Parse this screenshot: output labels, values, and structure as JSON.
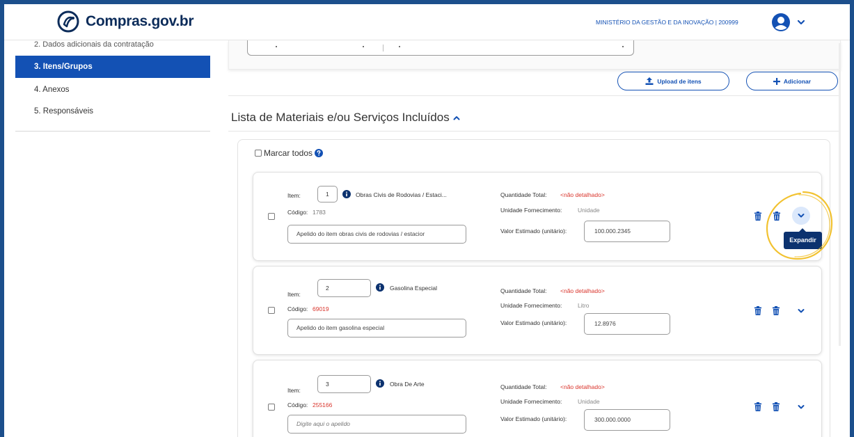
{
  "header": {
    "logo_text": "Compras.gov.br",
    "organization": "MINISTÉRIO DA GESTÃO E DA INOVAÇÃO | 200999"
  },
  "sidebar": {
    "items": [
      {
        "label": "2. Dados adicionais da contratação",
        "active": false
      },
      {
        "label": "3. Itens/Grupos",
        "active": true
      },
      {
        "label": "4. Anexos",
        "active": false
      },
      {
        "label": "5. Responsáveis",
        "active": false
      }
    ]
  },
  "toolbar": {
    "upload_label": "Upload de itens",
    "add_label": "Adicionar"
  },
  "section": {
    "title": "Lista de Materiais e/ou Serviços Incluídos",
    "select_all_label": "Marcar todos"
  },
  "labels": {
    "item": "Item:",
    "codigo": "Código:",
    "quantidade_total": "Quantidade Total:",
    "unidade_fornecimento": "Unidade Fornecimento:",
    "valor_estimado": "Valor Estimado (unitário):"
  },
  "items": [
    {
      "number": "1",
      "name": "Obras Civis de Rodovias / Estaci...",
      "codigo": "1783",
      "apelido": "Apelido do item obras civis de rodovias / estacior",
      "quantidade_total": "<não detalhado>",
      "unidade": "Unidade",
      "valor": "100.000.2345"
    },
    {
      "number": "2",
      "name": "Gasolina Especial",
      "codigo": "69019",
      "apelido": "Apelido do item gasolina especial",
      "quantidade_total": "<não detalhado>",
      "unidade": "Litro",
      "valor": "12.8976"
    },
    {
      "number": "3",
      "name": "Obra De Arte",
      "codigo": "255166",
      "apelido_placeholder": "Digite aqui o apelido",
      "quantidade_total": "<não detalhado>",
      "unidade": "Unidade",
      "valor": "300.000.0000"
    }
  ],
  "tooltip": {
    "expand": "Expandir"
  },
  "colors": {
    "primary": "#1351b4",
    "dark_blue": "#0c326f",
    "error_red": "#d9342b",
    "highlight": "#f2c230",
    "frame": "#1c4f8c"
  },
  "icons": [
    "compras-logo-icon",
    "user-avatar-icon",
    "chevron-down-icon",
    "upload-icon",
    "plus-icon",
    "chevron-up-icon",
    "question-circle-icon",
    "info-circle-icon",
    "trash-icon"
  ]
}
